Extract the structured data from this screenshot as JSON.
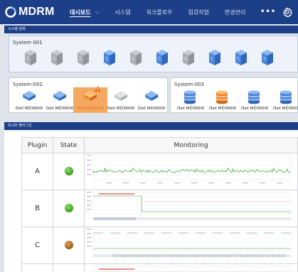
{
  "app": {
    "logo_text": "MDRM",
    "nav": [
      {
        "label": "대시보드",
        "active": true
      },
      {
        "label": "시스템"
      },
      {
        "label": "워크플로우"
      },
      {
        "label": "점검작업"
      },
      {
        "label": "변경관리"
      }
    ],
    "more_label": "•••",
    "colors": {
      "header": "#1d3f87",
      "ok": "#3a9b1e",
      "warn": "#e0701a",
      "server": "#4a86d8"
    }
  },
  "system_status": {
    "header": "시스템 상태",
    "system001": {
      "title": "System 001",
      "servers": [
        "gray",
        "gray",
        "gray",
        "blue",
        "gray",
        "blue",
        "gray",
        "blue",
        "blue",
        "blue"
      ]
    },
    "system002": {
      "title": "System-002",
      "devices": [
        {
          "label": "Dell MD3600f",
          "status": "normal"
        },
        {
          "label": "Dell MD3600f",
          "status": "normal"
        },
        {
          "label": "Dell MD3600f",
          "status": "warning"
        },
        {
          "label": "Dell MD3600f",
          "status": "off"
        },
        {
          "label": "Dell MD3600f",
          "status": "normal"
        }
      ]
    },
    "system003": {
      "title": "System-003",
      "devices": [
        {
          "label": "Dell MD3600f",
          "status": "normal"
        },
        {
          "label": "Dell MD3600f",
          "status": "warning"
        },
        {
          "label": "Dell MD3600f",
          "status": "normal"
        },
        {
          "label": "Dell MD3600f",
          "status": "normal"
        }
      ]
    }
  },
  "monitoring": {
    "header": "모니터 플러그인",
    "columns": {
      "plugin": "Plugin",
      "state": "State",
      "monitoring": "Monitoring"
    },
    "rows": [
      {
        "plugin": "A",
        "state": "green"
      },
      {
        "plugin": "B",
        "state": "green"
      },
      {
        "plugin": "C",
        "state": "brown"
      }
    ]
  }
}
